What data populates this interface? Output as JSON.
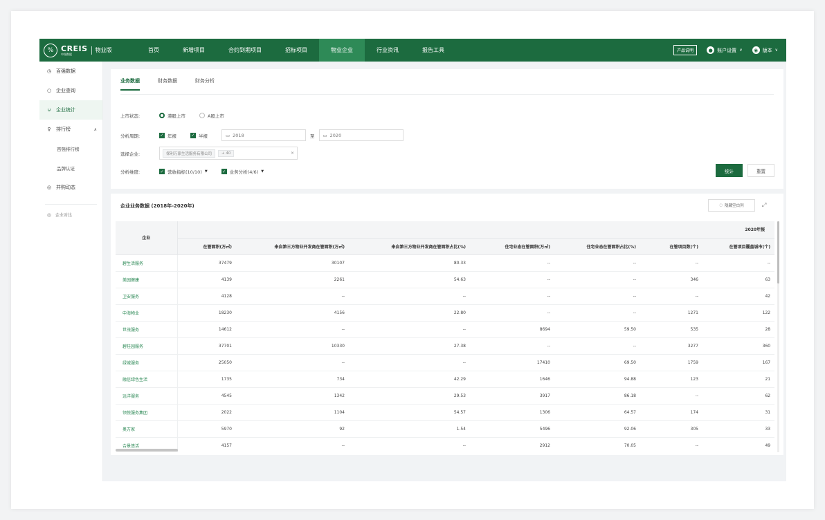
{
  "nav": {
    "logo_name": "CREIS",
    "logo_sub": "中指数据",
    "edition": "物业版",
    "items": [
      "首页",
      "新增项目",
      "合约到期项目",
      "招标项目",
      "物业企业",
      "行业资讯",
      "报告工具"
    ],
    "active_index": 4,
    "product_btn": "产品说明",
    "account": "账户设置",
    "version": "版本"
  },
  "sidebar": {
    "items": [
      {
        "icon": "database-icon",
        "glyph": "◷",
        "label": "百强数据"
      },
      {
        "icon": "search-icon",
        "glyph": "○",
        "label": "企业查询"
      },
      {
        "icon": "chart-icon",
        "glyph": "⊍",
        "label": "企业统计"
      },
      {
        "icon": "trophy-icon",
        "glyph": "♀",
        "label": "排行榜"
      }
    ],
    "active_index": 2,
    "sub_items": [
      "百强排行榜",
      "品牌认证"
    ],
    "last_item": {
      "icon": "trend-icon",
      "glyph": "◎",
      "label": "并购动态"
    },
    "footer": "企业对比"
  },
  "filters": {
    "tabs": [
      "业务数据",
      "财务数据",
      "财务分析"
    ],
    "active_tab": 0,
    "listing_label": "上市状态:",
    "listing_options": [
      "港股上市",
      "A股上市"
    ],
    "period_label": "分析周期:",
    "period_options": [
      "年报",
      "半报"
    ],
    "date_from": "2018",
    "date_sep": "至",
    "date_to": "2020",
    "company_label": "选择企业:",
    "company_tag": "保利万家生活服务有限公司",
    "company_more": "+ 40",
    "metric_label": "分析维度:",
    "metric_a": "营收指标(10/10)",
    "metric_b": "业务分析(4/6)",
    "submit": "统计",
    "reset": "重置"
  },
  "table": {
    "title": "企业业务数据 (2018年-2020年)",
    "hide_btn": "隐藏空白列",
    "corner": "企业",
    "year": "2020年报",
    "columns": [
      "在管面积(万㎡)",
      "来自第三方物业开发商在管面积(万㎡)",
      "来自第三方物业开发商在管面积占比(%)",
      "住宅业态在管面积(万㎡)",
      "住宅业态在管面积占比(%)",
      "在管项目数(个)",
      "在管项目覆盖城市(个)"
    ],
    "rows": [
      {
        "name": "碧生活服务",
        "values": [
          "37479",
          "30107",
          "80.33",
          "--",
          "--",
          "--",
          "--"
        ]
      },
      {
        "name": "美园健康",
        "values": [
          "4139",
          "2261",
          "54.63",
          "--",
          "--",
          "346",
          "63"
        ]
      },
      {
        "name": "卫安服务",
        "values": [
          "4128",
          "--",
          "--",
          "--",
          "--",
          "--",
          "42"
        ]
      },
      {
        "name": "中海物业",
        "values": [
          "18230",
          "4156",
          "22.80",
          "--",
          "--",
          "1271",
          "122"
        ]
      },
      {
        "name": "世茂服务",
        "values": [
          "14612",
          "--",
          "--",
          "8694",
          "59.50",
          "535",
          "28"
        ]
      },
      {
        "name": "碧桂园服务",
        "values": [
          "37701",
          "10330",
          "27.38",
          "--",
          "--",
          "3277",
          "360"
        ]
      },
      {
        "name": "绿城服务",
        "values": [
          "25050",
          "--",
          "--",
          "17410",
          "69.50",
          "1759",
          "167"
        ]
      },
      {
        "name": "融信绿色生活",
        "values": [
          "1735",
          "734",
          "42.29",
          "1646",
          "94.88",
          "123",
          "21"
        ]
      },
      {
        "name": "远洋服务",
        "values": [
          "4545",
          "1342",
          "29.53",
          "3917",
          "86.18",
          "--",
          "62"
        ]
      },
      {
        "name": "领悦服务集团",
        "values": [
          "2022",
          "1104",
          "54.57",
          "1306",
          "64.57",
          "174",
          "31"
        ]
      },
      {
        "name": "奥万家",
        "values": [
          "5970",
          "92",
          "1.54",
          "5496",
          "92.06",
          "305",
          "33"
        ]
      },
      {
        "name": "合景悠活",
        "values": [
          "4157",
          "--",
          "--",
          "2912",
          "70.05",
          "--",
          "49"
        ]
      }
    ]
  }
}
